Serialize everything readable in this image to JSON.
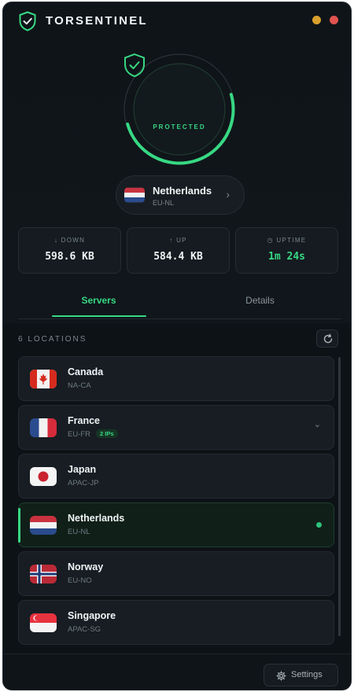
{
  "app": {
    "title": "TORSENTINEL"
  },
  "status": {
    "label": "PROTECTED",
    "color": "#37d883"
  },
  "current_location": {
    "name": "Netherlands",
    "code": "EU-NL",
    "chevron": "›"
  },
  "stats": {
    "down": {
      "label": "DOWN",
      "value": "598.6 KB",
      "icon": "arrow-down-icon"
    },
    "up": {
      "label": "UP",
      "value": "584.4 KB",
      "icon": "arrow-up-icon"
    },
    "uptime": {
      "label": "UPTIME",
      "value": "1m 24s",
      "icon": "timer-icon"
    }
  },
  "tabs": [
    {
      "label": "Servers",
      "active": true
    },
    {
      "label": "Details",
      "active": false
    }
  ],
  "server_list": {
    "count_label": "6 LOCATIONS",
    "items": [
      {
        "name": "Canada",
        "code": "NA-CA",
        "flag": "canada"
      },
      {
        "name": "France",
        "code": "EU-FR",
        "badge": "2 IPs",
        "flag": "france",
        "expandable": true,
        "chevron": "⌄"
      },
      {
        "name": "Japan",
        "code": "APAC-JP",
        "flag": "japan"
      },
      {
        "name": "Netherlands",
        "code": "EU-NL",
        "flag": "netherlands",
        "active": true
      },
      {
        "name": "Norway",
        "code": "EU-NO",
        "flag": "norway"
      },
      {
        "name": "Singapore",
        "code": "APAC-SG",
        "flag": "singapore"
      }
    ]
  },
  "footer": {
    "settings_label": "Settings"
  },
  "colors": {
    "accent": "#37d883",
    "background": "#0f1418",
    "window_min": "#d9a02e",
    "window_close": "#e0534e"
  }
}
